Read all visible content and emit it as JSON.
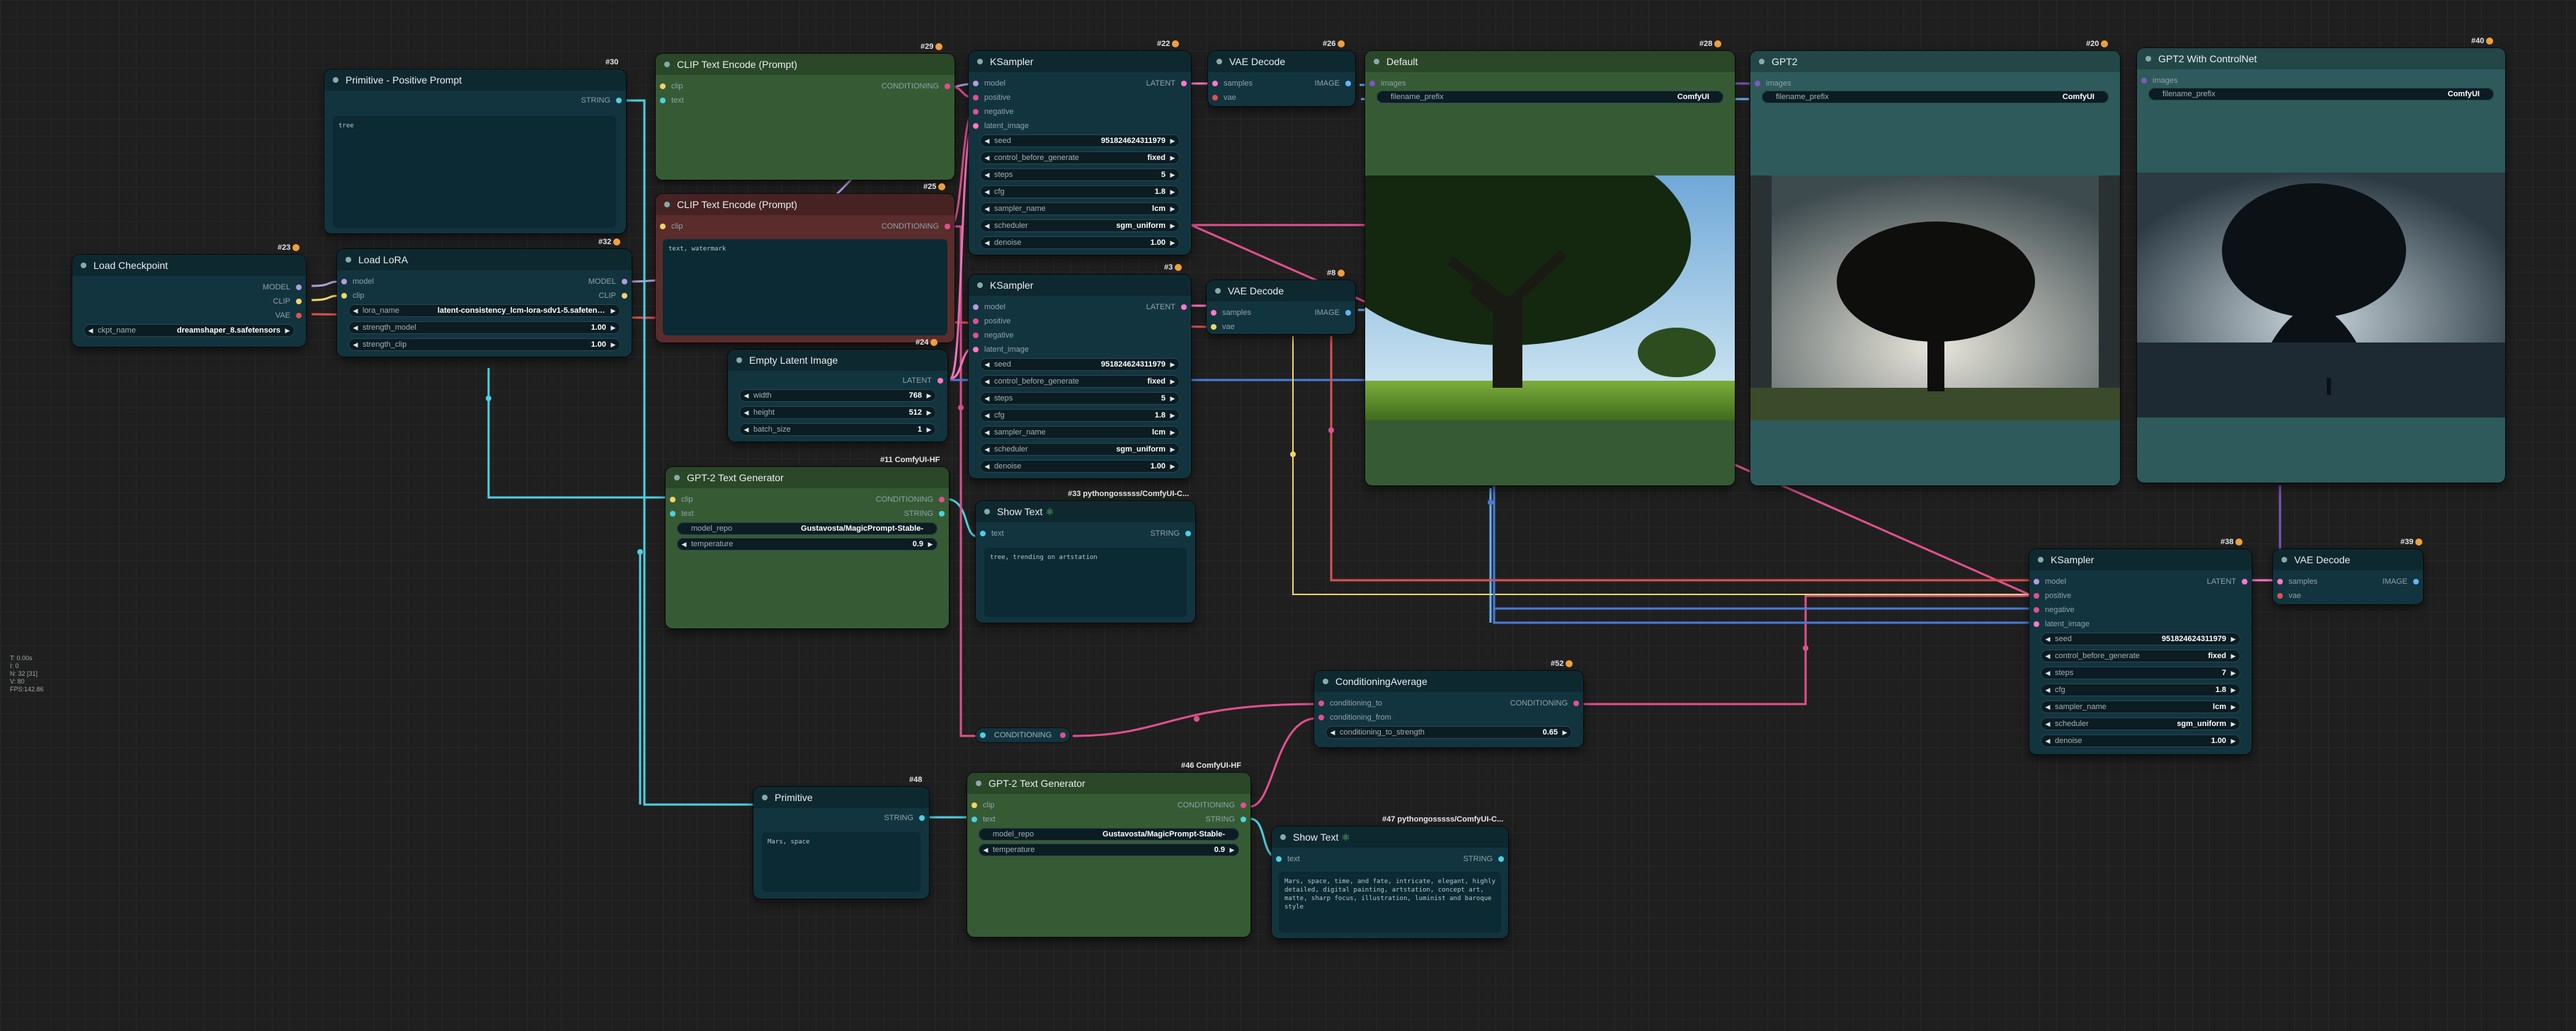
{
  "stats": [
    "T: 0.00s",
    "I: 0",
    "N: 32 [31]",
    "V: 80",
    "FPS:142.86"
  ],
  "nodes": {
    "load_checkpoint": {
      "title": "Load Checkpoint",
      "badge": "#23",
      "outputs": [
        "MODEL",
        "CLIP",
        "VAE"
      ],
      "ckpt_name_label": "ckpt_name",
      "ckpt_name": "dreamshaper_8.safetensors"
    },
    "primitive_pos": {
      "title": "Primitive - Positive Prompt",
      "badge": "#30",
      "output": "STRING",
      "text": "tree"
    },
    "load_lora": {
      "title": "Load LoRA",
      "badge": "#32",
      "inputs": [
        "model",
        "clip"
      ],
      "outputs": [
        "MODEL",
        "CLIP"
      ],
      "widgets": [
        {
          "k": "lora_name",
          "v": "latent-consistency_lcm-lora-sdv1-5.safetensors"
        },
        {
          "k": "strength_model",
          "v": "1.00"
        },
        {
          "k": "strength_clip",
          "v": "1.00"
        }
      ]
    },
    "clip_pos": {
      "title": "CLIP Text Encode (Prompt)",
      "badge": "#29",
      "inputs": [
        "clip",
        "text"
      ],
      "output": "CONDITIONING"
    },
    "clip_neg": {
      "title": "CLIP Text Encode (Prompt)",
      "badge": "#25",
      "input": "clip",
      "output": "CONDITIONING",
      "text": "text, watermark"
    },
    "empty_latent": {
      "title": "Empty Latent Image",
      "badge": "#24",
      "output": "LATENT",
      "widgets": [
        {
          "k": "width",
          "v": "768"
        },
        {
          "k": "height",
          "v": "512"
        },
        {
          "k": "batch_size",
          "v": "1"
        }
      ]
    },
    "gpt2_a": {
      "title": "GPT-2 Text Generator",
      "badge": "#11 ComfyUI-HF",
      "inputs": [
        "clip",
        "text"
      ],
      "outputs": [
        "CONDITIONING",
        "STRING"
      ],
      "widgets": [
        {
          "k": "model_repo",
          "v": "Gustavosta/MagicPrompt-Stable-"
        },
        {
          "k": "temperature",
          "v": "0.9"
        }
      ]
    },
    "ksampler_a": {
      "title": "KSampler",
      "badge": "#22",
      "inputs": [
        "model",
        "positive",
        "negative",
        "latent_image"
      ],
      "output": "LATENT",
      "widgets": [
        {
          "k": "seed",
          "v": "951824624311979"
        },
        {
          "k": "control_before_generate",
          "v": "fixed"
        },
        {
          "k": "steps",
          "v": "5"
        },
        {
          "k": "cfg",
          "v": "1.8"
        },
        {
          "k": "sampler_name",
          "v": "lcm"
        },
        {
          "k": "scheduler",
          "v": "sgm_uniform"
        },
        {
          "k": "denoise",
          "v": "1.00"
        }
      ]
    },
    "ksampler_b": {
      "title": "KSampler",
      "badge": "#3",
      "inputs": [
        "model",
        "positive",
        "negative",
        "latent_image"
      ],
      "output": "LATENT",
      "widgets": [
        {
          "k": "seed",
          "v": "951824624311979"
        },
        {
          "k": "control_before_generate",
          "v": "fixed"
        },
        {
          "k": "steps",
          "v": "5"
        },
        {
          "k": "cfg",
          "v": "1.8"
        },
        {
          "k": "sampler_name",
          "v": "lcm"
        },
        {
          "k": "scheduler",
          "v": "sgm_uniform"
        },
        {
          "k": "denoise",
          "v": "1.00"
        }
      ]
    },
    "show_text_a": {
      "title": "Show Text",
      "badge": "#33 pythongosssss/ComfyUI-C...",
      "input": "text",
      "output": "STRING",
      "text": "tree, trending on artstation"
    },
    "vae_a": {
      "title": "VAE Decode",
      "badge": "#26",
      "inputs": [
        "samples",
        "vae"
      ],
      "output": "IMAGE"
    },
    "vae_b": {
      "title": "VAE Decode",
      "badge": "#8",
      "inputs": [
        "samples",
        "vae"
      ],
      "output": "IMAGE"
    },
    "save_default": {
      "title": "Default",
      "badge": "#28",
      "input": "images",
      "widget": {
        "k": "filename_prefix",
        "v": "ComfyUI"
      }
    },
    "save_gpt2": {
      "title": "GPT2",
      "badge": "#20",
      "input": "images",
      "widget": {
        "k": "filename_prefix",
        "v": "ComfyUI"
      }
    },
    "save_cn": {
      "title": "GPT2 With ControlNet",
      "badge": "#40",
      "input": "images",
      "widget": {
        "k": "filename_prefix",
        "v": "ComfyUI"
      }
    },
    "ksampler_c": {
      "title": "KSampler",
      "badge": "#38",
      "inputs": [
        "model",
        "positive",
        "negative",
        "latent_image"
      ],
      "output": "LATENT",
      "widgets": [
        {
          "k": "seed",
          "v": "951824624311979"
        },
        {
          "k": "control_before_generate",
          "v": "fixed"
        },
        {
          "k": "steps",
          "v": "7"
        },
        {
          "k": "cfg",
          "v": "1.8"
        },
        {
          "k": "sampler_name",
          "v": "lcm"
        },
        {
          "k": "scheduler",
          "v": "sgm_uniform"
        },
        {
          "k": "denoise",
          "v": "1.00"
        }
      ]
    },
    "vae_c": {
      "title": "VAE Decode",
      "badge": "#39",
      "inputs": [
        "samples",
        "vae"
      ],
      "output": "IMAGE"
    },
    "cond_avg": {
      "title": "ConditioningAverage",
      "badge": "#52",
      "inputs": [
        "conditioning_to",
        "conditioning_from"
      ],
      "output": "CONDITIONING",
      "widget": {
        "k": "conditioning_to_strength",
        "v": "0.65"
      }
    },
    "reroute": {
      "label": "CONDITIONING"
    },
    "primitive_b": {
      "title": "Primitive",
      "badge": "#48",
      "output": "STRING",
      "text": "Mars, space"
    },
    "gpt2_b": {
      "title": "GPT-2 Text Generator",
      "badge": "#46 ComfyUI-HF",
      "inputs": [
        "clip",
        "text"
      ],
      "outputs": [
        "CONDITIONING",
        "STRING"
      ],
      "widgets": [
        {
          "k": "model_repo",
          "v": "Gustavosta/MagicPrompt-Stable-"
        },
        {
          "k": "temperature",
          "v": "0.9"
        }
      ]
    },
    "show_text_b": {
      "title": "Show Text",
      "badge": "#47 pythongosssss/ComfyUI-C...",
      "input": "text",
      "output": "STRING",
      "text": "Mars, space, time, and fate, intricate, elegant, highly detailed, digital painting, artstation, concept art, matte, sharp focus, illustration, luminist and baroque style"
    }
  }
}
